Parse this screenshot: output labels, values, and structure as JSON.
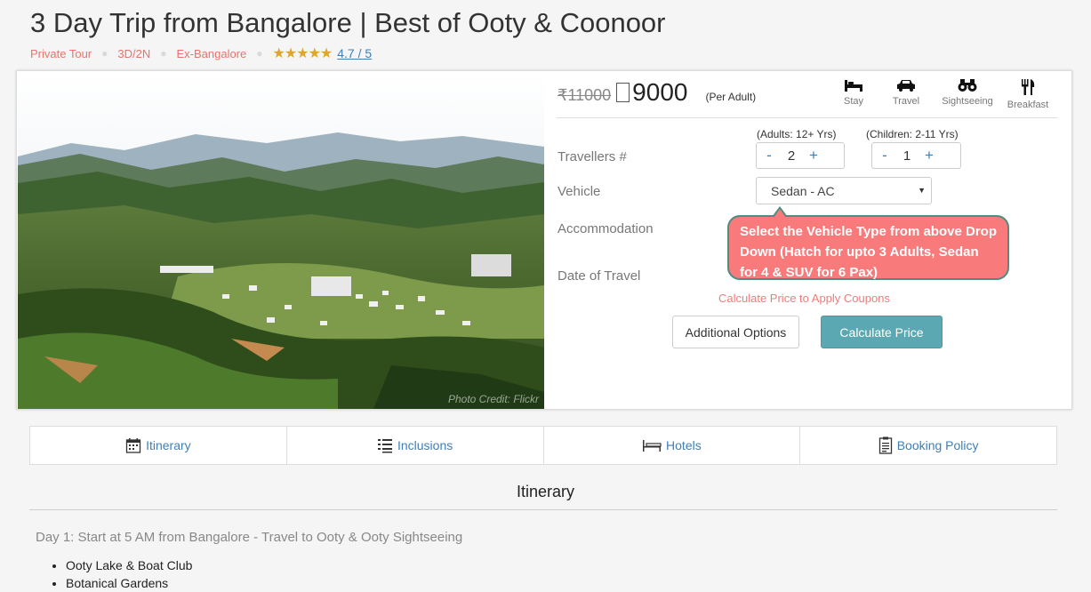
{
  "header": {
    "title": "3 Day Trip from Bangalore | Best of Ooty & Coonoor",
    "tags": [
      "Private Tour",
      "3D/2N",
      "Ex-Bangalore"
    ],
    "stars": "★★★★★",
    "rating_text": "4.7 / 5",
    "rating_value": 4.7
  },
  "photo": {
    "credit": "Photo Credit: Flickr"
  },
  "pricing": {
    "old_price": "11000",
    "new_price": "9000",
    "per_unit": "(Per Adult)"
  },
  "features": [
    {
      "icon": "bed-icon",
      "label": "Stay"
    },
    {
      "icon": "car-icon",
      "label": "Travel"
    },
    {
      "icon": "binoculars-icon",
      "label": "Sightseeing"
    },
    {
      "icon": "fork-knife-icon",
      "label": "Breakfast"
    }
  ],
  "form": {
    "travellers_label": "Travellers #",
    "adults_label": "(Adults: 12+ Yrs)",
    "children_label": "(Children: 2-11 Yrs)",
    "adults_value": "2",
    "children_value": "1",
    "minus": "-",
    "plus": "+",
    "vehicle_label": "Vehicle",
    "vehicle_value": "Sedan - AC",
    "accommodation_label": "Accommodation",
    "date_label": "Date of Travel"
  },
  "tooltip": {
    "text": "Select the Vehicle Type from above Drop Down (Hatch for upto 3 Adults, Sedan for 4 & SUV for 6 Pax)"
  },
  "actions": {
    "coupon_note": "Calculate Price to Apply Coupons",
    "additional_options": "Additional Options",
    "calculate_price": "Calculate Price"
  },
  "tabs": [
    {
      "icon": "calendar-icon",
      "label": "Itinerary"
    },
    {
      "icon": "checklist-icon",
      "label": "Inclusions"
    },
    {
      "icon": "bed-icon",
      "label": "Hotels"
    },
    {
      "icon": "document-icon",
      "label": "Booking Policy"
    }
  ],
  "itinerary": {
    "section_title": "Itinerary",
    "day1_title": "Day 1: Start at 5 AM from Bangalore - Travel to Ooty & Ooty Sightseeing",
    "day1_items": [
      "Ooty Lake & Boat Club",
      "Botanical Gardens"
    ]
  },
  "colors": {
    "accent_blue": "#3f7fb7",
    "tag_red": "#e8736b",
    "star_gold": "#e0a52b",
    "primary_button": "#5ba8b2",
    "tooltip_bg": "#f87a7a",
    "tooltip_border": "#4e8d80"
  }
}
